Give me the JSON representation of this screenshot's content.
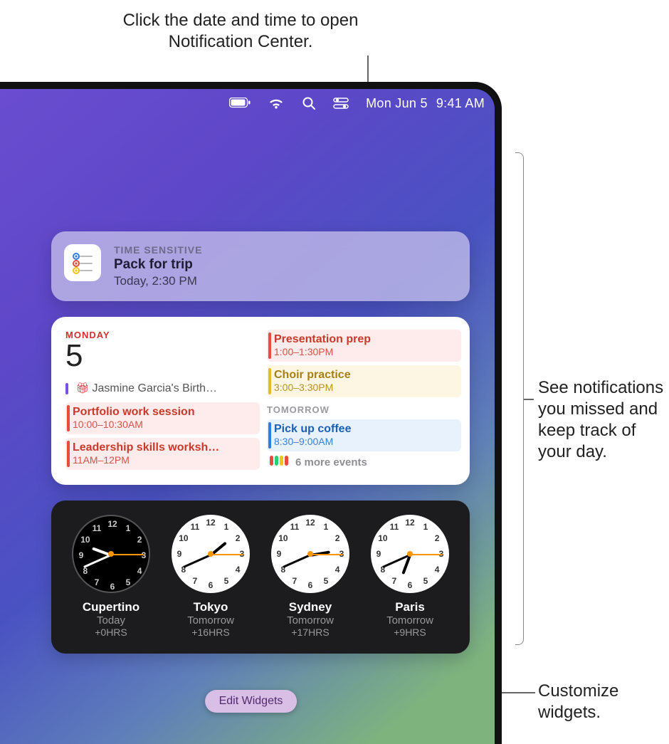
{
  "callouts": {
    "top": "Click the date and time to open Notification Center.",
    "right": "See notifications you missed and keep track of your day.",
    "bottom": "Customize widgets."
  },
  "menubar": {
    "date": "Mon Jun 5",
    "time": "9:41 AM"
  },
  "notification": {
    "category": "TIME SENSITIVE",
    "title": "Pack for trip",
    "subtitle": "Today, 2:30 PM"
  },
  "calendar": {
    "dayLabel": "MONDAY",
    "dayNum": "5",
    "birthday": "Jasmine Garcia's Birth…",
    "events_left": [
      {
        "title": "Portfolio work session",
        "time": "10:00–10:30AM",
        "color": "red"
      },
      {
        "title": "Leadership skills worksh…",
        "time": "11AM–12PM",
        "color": "red"
      }
    ],
    "events_right": [
      {
        "title": "Presentation prep",
        "time": "1:00–1:30PM",
        "color": "red"
      },
      {
        "title": "Choir practice",
        "time": "3:00–3:30PM",
        "color": "yellow"
      }
    ],
    "tomorrowLabel": "TOMORROW",
    "tomorrow_event": {
      "title": "Pick up coffee",
      "time": "8:30–9:00AM",
      "color": "blue"
    },
    "more": "6 more events"
  },
  "clocks": [
    {
      "city": "Cupertino",
      "day": "Today",
      "offset": "+0HRS",
      "face": "dark",
      "h": 9,
      "m": 41
    },
    {
      "city": "Tokyo",
      "day": "Tomorrow",
      "offset": "+16HRS",
      "face": "light",
      "h": 1,
      "m": 41
    },
    {
      "city": "Sydney",
      "day": "Tomorrow",
      "offset": "+17HRS",
      "face": "light",
      "h": 2,
      "m": 41
    },
    {
      "city": "Paris",
      "day": "Tomorrow",
      "offset": "+9HRS",
      "face": "light",
      "h": 6,
      "m": 41
    }
  ],
  "editWidgets": "Edit Widgets"
}
